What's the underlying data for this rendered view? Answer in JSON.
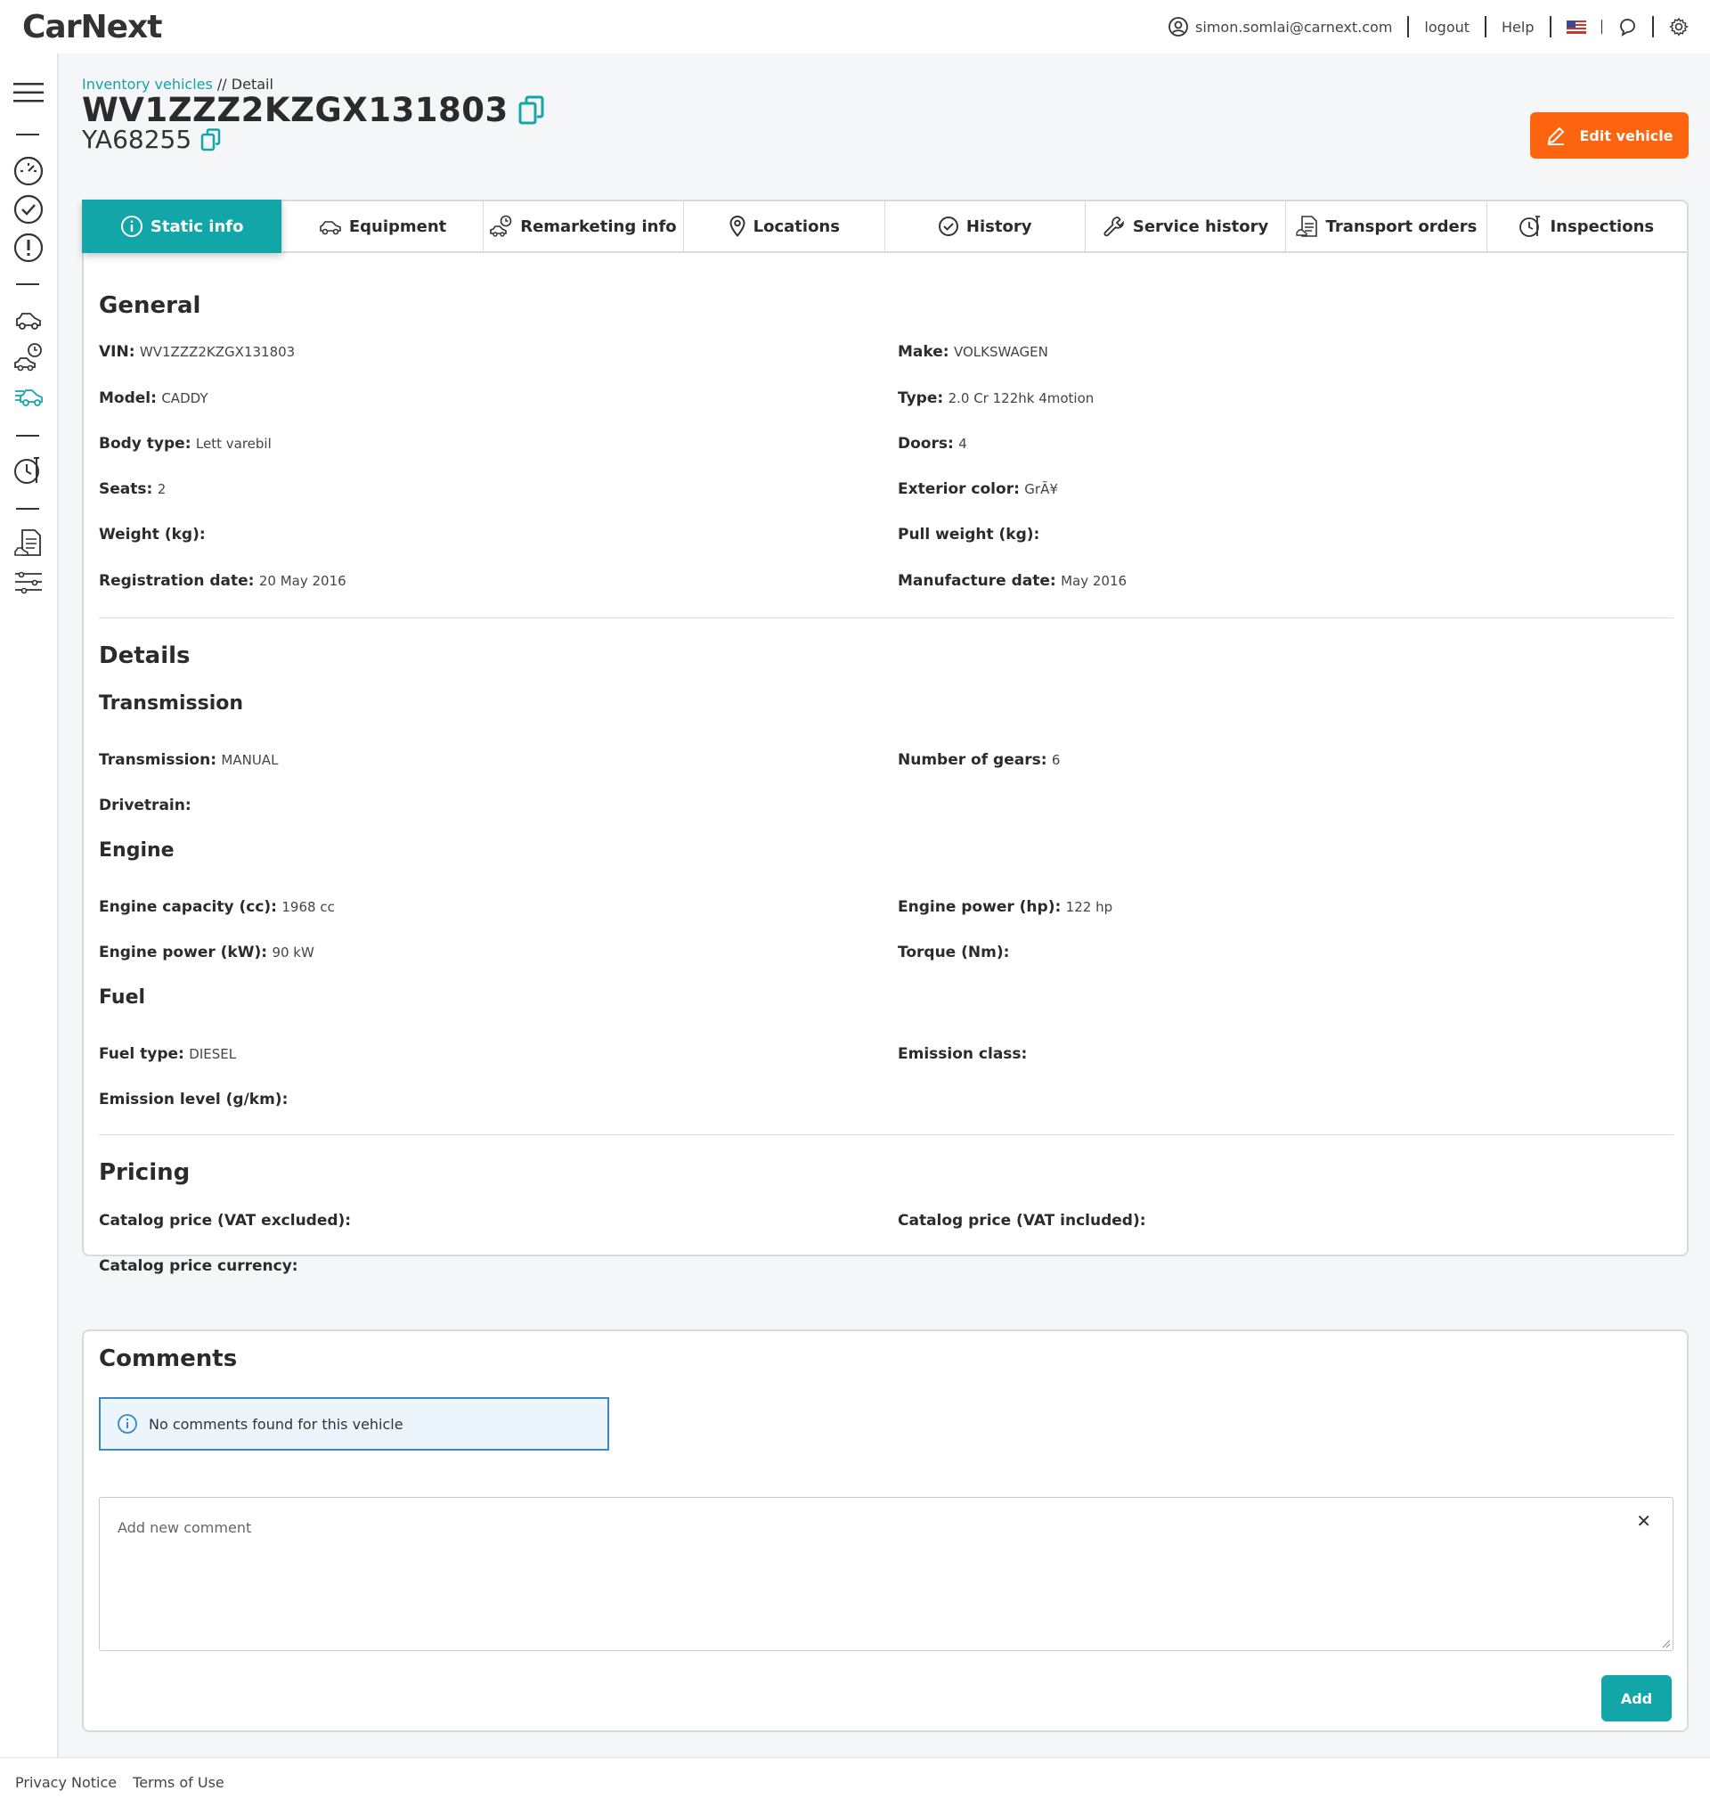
{
  "app": {
    "logo": "CarNext"
  },
  "topnav": {
    "user_email": "simon.somlai@carnext.com",
    "logout": "logout",
    "help": "Help"
  },
  "breadcrumb": {
    "parent": "Inventory vehicles",
    "sep": " // ",
    "current": "Detail"
  },
  "vehicle": {
    "vin": "WV1ZZZ2KZGX131803",
    "plate": "YA68255"
  },
  "actions": {
    "edit_vehicle": "Edit vehicle"
  },
  "tabs": [
    {
      "label": "Static info",
      "icon": "info-icon"
    },
    {
      "label": "Equipment",
      "icon": "car-icon"
    },
    {
      "label": "Remarketing info",
      "icon": "remarketing-icon"
    },
    {
      "label": "Locations",
      "icon": "location-pin-icon"
    },
    {
      "label": "History",
      "icon": "check-circle-icon"
    },
    {
      "label": "Service history",
      "icon": "wrench-icon"
    },
    {
      "label": "Transport orders",
      "icon": "transport-doc-icon"
    },
    {
      "label": "Inspections",
      "icon": "inspection-icon"
    }
  ],
  "general": {
    "title": "General",
    "fields": [
      {
        "label": "VIN:",
        "value": "WV1ZZZ2KZGX131803"
      },
      {
        "label": "Make:",
        "value": "VOLKSWAGEN"
      },
      {
        "label": "Model:",
        "value": "CADDY"
      },
      {
        "label": "Type:",
        "value": "2.0 Cr 122hk 4motion"
      },
      {
        "label": "Body type:",
        "value": "Lett varebil"
      },
      {
        "label": "Doors:",
        "value": "4"
      },
      {
        "label": "Seats:",
        "value": "2"
      },
      {
        "label": "Exterior color:",
        "value": "GrÃ¥"
      },
      {
        "label": "Weight (kg):",
        "value": ""
      },
      {
        "label": "Pull weight (kg):",
        "value": ""
      },
      {
        "label": "Registration date:",
        "value": "20 May 2016"
      },
      {
        "label": "Manufacture date:",
        "value": "May 2016"
      }
    ]
  },
  "details": {
    "title": "Details",
    "transmission": {
      "title": "Transmission",
      "fields": [
        {
          "label": "Transmission:",
          "value": "MANUAL"
        },
        {
          "label": "Number of gears:",
          "value": "6"
        },
        {
          "label": "Drivetrain:",
          "value": ""
        }
      ]
    },
    "engine": {
      "title": "Engine",
      "fields": [
        {
          "label": "Engine capacity (cc):",
          "value": "1968 cc"
        },
        {
          "label": "Engine power (hp):",
          "value": "122 hp"
        },
        {
          "label": "Engine power (kW):",
          "value": "90 kW"
        },
        {
          "label": "Torque (Nm):",
          "value": ""
        }
      ]
    },
    "fuel": {
      "title": "Fuel",
      "fields": [
        {
          "label": "Fuel type:",
          "value": "DIESEL"
        },
        {
          "label": "Emission class:",
          "value": ""
        },
        {
          "label": "Emission level (g/km):",
          "value": ""
        }
      ]
    }
  },
  "pricing": {
    "title": "Pricing",
    "fields": [
      {
        "label": "Catalog price (VAT excluded):",
        "value": ""
      },
      {
        "label": "Catalog price (VAT included):",
        "value": ""
      },
      {
        "label": "Catalog price currency:",
        "value": ""
      }
    ]
  },
  "comments": {
    "title": "Comments",
    "empty_message": "No comments found for this vehicle",
    "placeholder": "Add new comment",
    "close": "✕",
    "add_button": "Add"
  },
  "footer": {
    "privacy": "Privacy Notice",
    "terms": "Terms of Use"
  },
  "colors": {
    "accent": "#12a6a8",
    "edit": "#fd6410",
    "alert_border": "#3a86c7"
  }
}
